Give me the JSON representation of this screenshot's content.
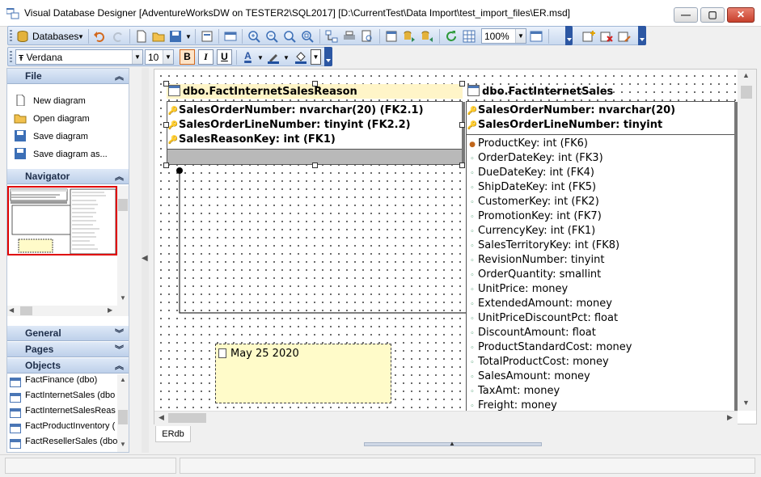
{
  "window": {
    "title": "Visual Database Designer [AdventureWorksDW on TESTER2\\SQL2017] [D:\\CurrentTest\\Data Import\\test_import_files\\ER.msd]",
    "minimize": "—",
    "maximize": "▢",
    "close": "✕"
  },
  "toolbar": {
    "databases_label": "Databases",
    "zoom_value": "100%",
    "font_name": "Verdana",
    "font_size": "10",
    "bold": "B",
    "italic": "I",
    "underline": "U",
    "font_color_glyph": "A"
  },
  "left_panel": {
    "file_header": "File",
    "file_items": [
      "New diagram",
      "Open diagram",
      "Save diagram",
      "Save diagram as..."
    ],
    "navigator_header": "Navigator",
    "general_header": "General",
    "pages_header": "Pages",
    "objects_header": "Objects",
    "objects": [
      "FactFinance (dbo)",
      "FactInternetSales (dbo",
      "FactInternetSalesReas",
      "FactProductInventory (",
      "FactResellerSales (dbo"
    ]
  },
  "diagram": {
    "entity1": {
      "title": "dbo.FactInternetSalesReason",
      "pk_fields": [
        "SalesOrderNumber: nvarchar(20) (FK2.1)",
        "SalesOrderLineNumber: tinyint (FK2.2)",
        "SalesReasonKey: int (FK1)"
      ]
    },
    "entity2": {
      "title": "dbo.FactInternetSales",
      "pk_fields": [
        "SalesOrderNumber: nvarchar(20)",
        "SalesOrderLineNumber: tinyint"
      ],
      "fields": [
        "ProductKey: int (FK6)",
        "OrderDateKey: int (FK3)",
        "DueDateKey: int (FK4)",
        "ShipDateKey: int (FK5)",
        "CustomerKey: int (FK2)",
        "PromotionKey: int (FK7)",
        "CurrencyKey: int (FK1)",
        "SalesTerritoryKey: int (FK8)",
        "RevisionNumber: tinyint",
        "OrderQuantity: smallint",
        "UnitPrice: money",
        "ExtendedAmount: money",
        "UnitPriceDiscountPct: float",
        "DiscountAmount: float",
        "ProductStandardCost: money",
        "TotalProductCost: money",
        "SalesAmount: money",
        "TaxAmt: money",
        "Freight: money"
      ]
    },
    "note_text": "May 25 2020"
  },
  "tabs": [
    "ERdb"
  ],
  "colors": {
    "accent": "#2c57a3",
    "note_bg": "#fffbc9",
    "entity_title_bg": "#fff5c8",
    "selection": "#e00000"
  }
}
